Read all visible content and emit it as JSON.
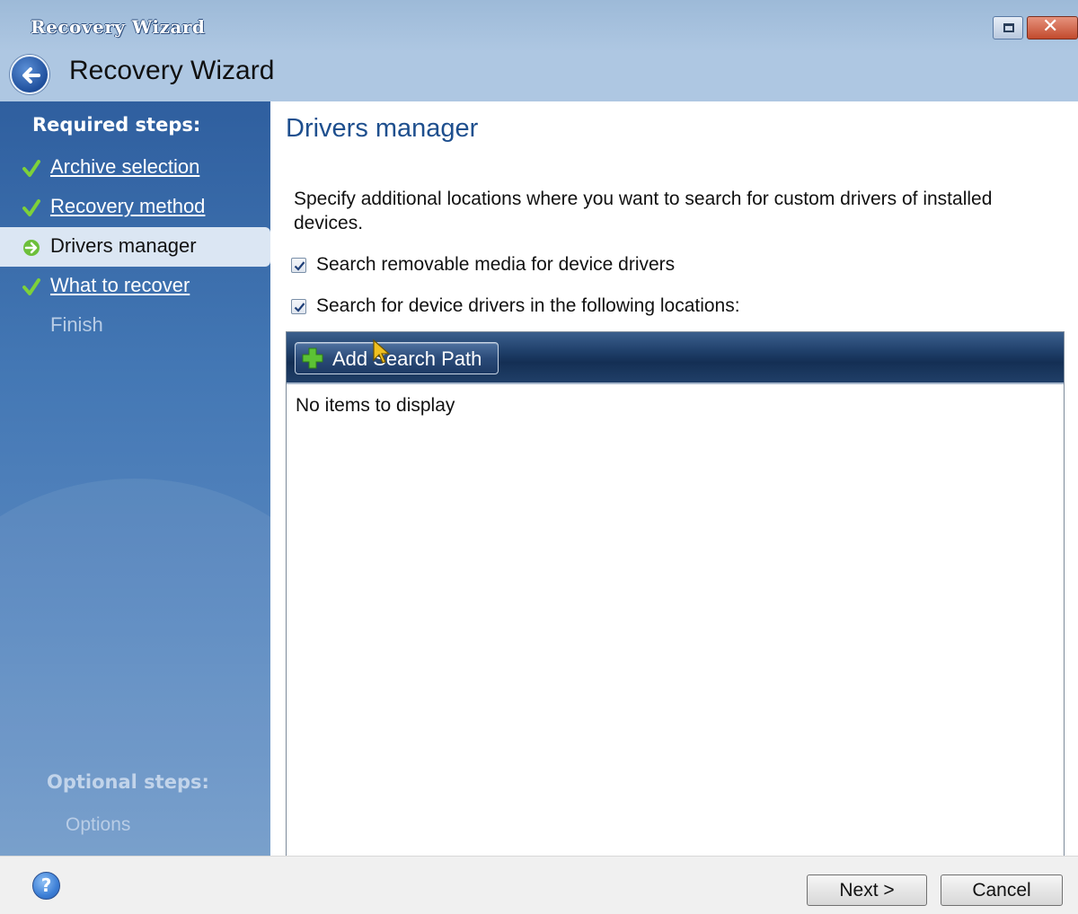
{
  "window": {
    "title": "Recovery Wizard",
    "close_glyph": "✕"
  },
  "header": {
    "title": "Recovery Wizard",
    "back_icon": "back-arrow-icon"
  },
  "sidebar": {
    "required_heading": "Required steps:",
    "steps": [
      {
        "label": "Archive selection",
        "state": "done",
        "icon": "checkmark-icon"
      },
      {
        "label": "Recovery method",
        "state": "done",
        "icon": "checkmark-icon"
      },
      {
        "label": "Drivers manager",
        "state": "active",
        "icon": "arrow-right-icon"
      },
      {
        "label": "What to recover",
        "state": "done",
        "icon": "checkmark-icon"
      },
      {
        "label": "Finish",
        "state": "future",
        "icon": ""
      }
    ],
    "optional_heading": "Optional steps:",
    "optional_items": [
      {
        "label": "Options"
      }
    ]
  },
  "main": {
    "title": "Drivers manager",
    "description": "Specify additional locations where you want to search for custom drivers of installed devices.",
    "checkbox_removable": {
      "label": "Search removable media for device drivers",
      "checked": true
    },
    "checkbox_locations": {
      "label": "Search for device drivers in the following locations:",
      "checked": true
    },
    "toolbar": {
      "add_path_label": "Add Search Path",
      "add_path_icon": "plus-icon"
    },
    "list": {
      "empty_text": "No items to display"
    }
  },
  "footer": {
    "help_label": "?",
    "next_label": "Next >",
    "cancel_label": "Cancel"
  },
  "colors": {
    "titlebar": "#aec7e2",
    "sidebar_top": "#2f5f9f",
    "sidebar_active": "#dbe6f3",
    "main_title": "#1e4f8e",
    "toolbar_dark": "#142f54",
    "check_green": "#7dd13a"
  }
}
